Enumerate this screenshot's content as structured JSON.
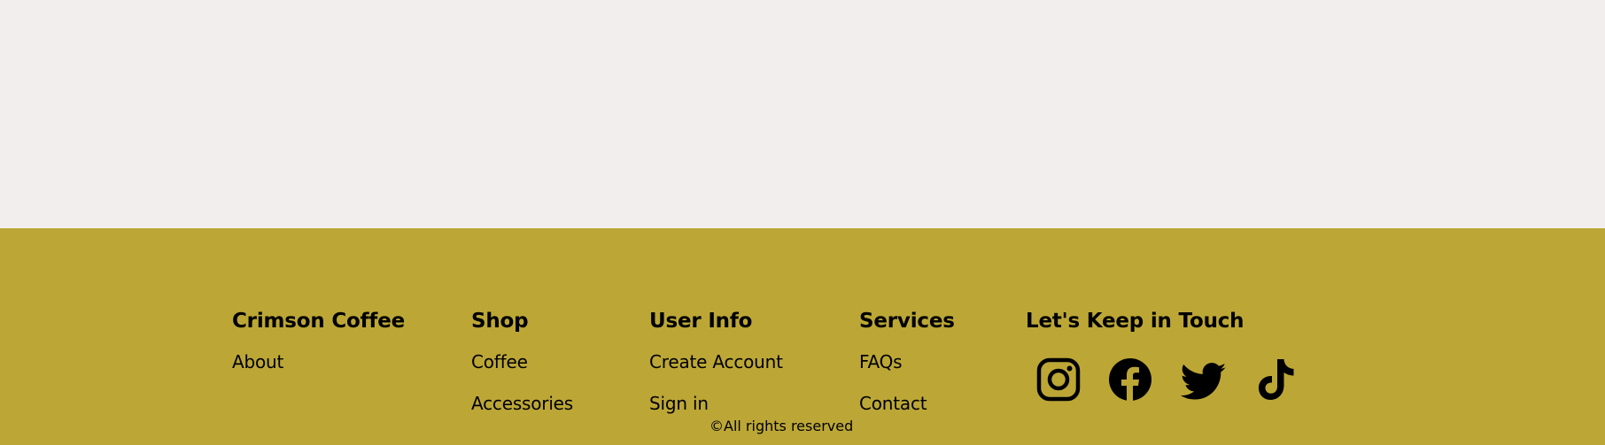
{
  "colors": {
    "page_background": "#f2eeee",
    "footer_background": "#bca736",
    "text": "#000000"
  },
  "footer": {
    "brand": {
      "heading": "Crimson Coffee",
      "links": [
        "About"
      ]
    },
    "shop": {
      "heading": "Shop",
      "links": [
        "Coffee",
        "Accessories"
      ]
    },
    "user_info": {
      "heading": "User Info",
      "links": [
        "Create Account",
        "Sign in"
      ]
    },
    "services": {
      "heading": "Services",
      "links": [
        "FAQs",
        "Contact"
      ]
    },
    "contact": {
      "heading": "Let's Keep in Touch",
      "icons": [
        "instagram-icon",
        "facebook-icon",
        "twitter-icon",
        "tiktok-icon"
      ]
    },
    "copyright": "©All rights reserved"
  }
}
